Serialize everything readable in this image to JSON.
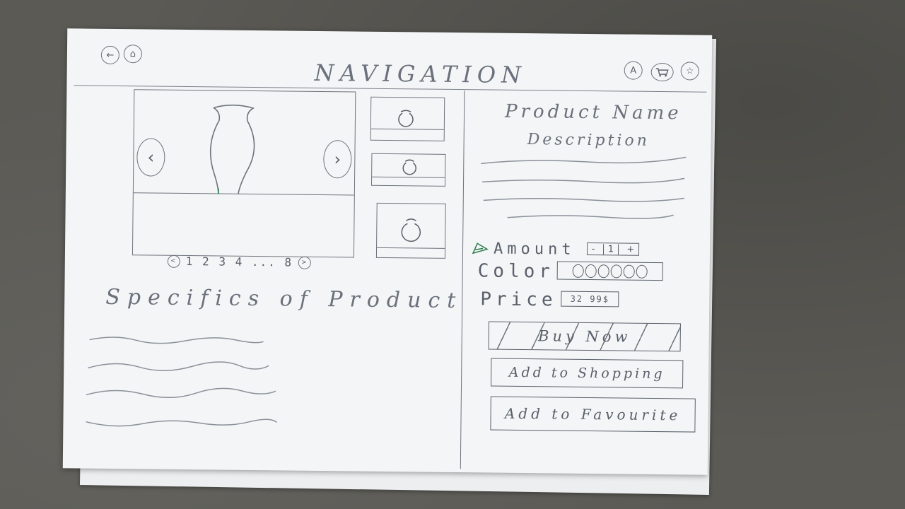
{
  "header": {
    "title": "NAVIGATION",
    "left_icons": [
      "back-arrow-icon",
      "home-icon"
    ],
    "right_icons": [
      "account-icon",
      "cart-icon",
      "star-icon"
    ]
  },
  "gallery": {
    "pager": {
      "pages": "1 2 3 4 ... 8",
      "prev": "<",
      "next": ">"
    }
  },
  "product": {
    "name": "Product Name",
    "description_heading": "Description",
    "amount_label": "Amount",
    "amount_value": "1",
    "minus": "-",
    "plus": "+",
    "color_label": "Color",
    "price_label": "Price",
    "price_value": "32 99$",
    "buttons": {
      "buy_now": "Buy Now",
      "add_to_shopping": "Add to Shopping",
      "add_to_favourite": "Add to Favourite"
    }
  },
  "specifics": {
    "title": "Specifics of Product"
  }
}
